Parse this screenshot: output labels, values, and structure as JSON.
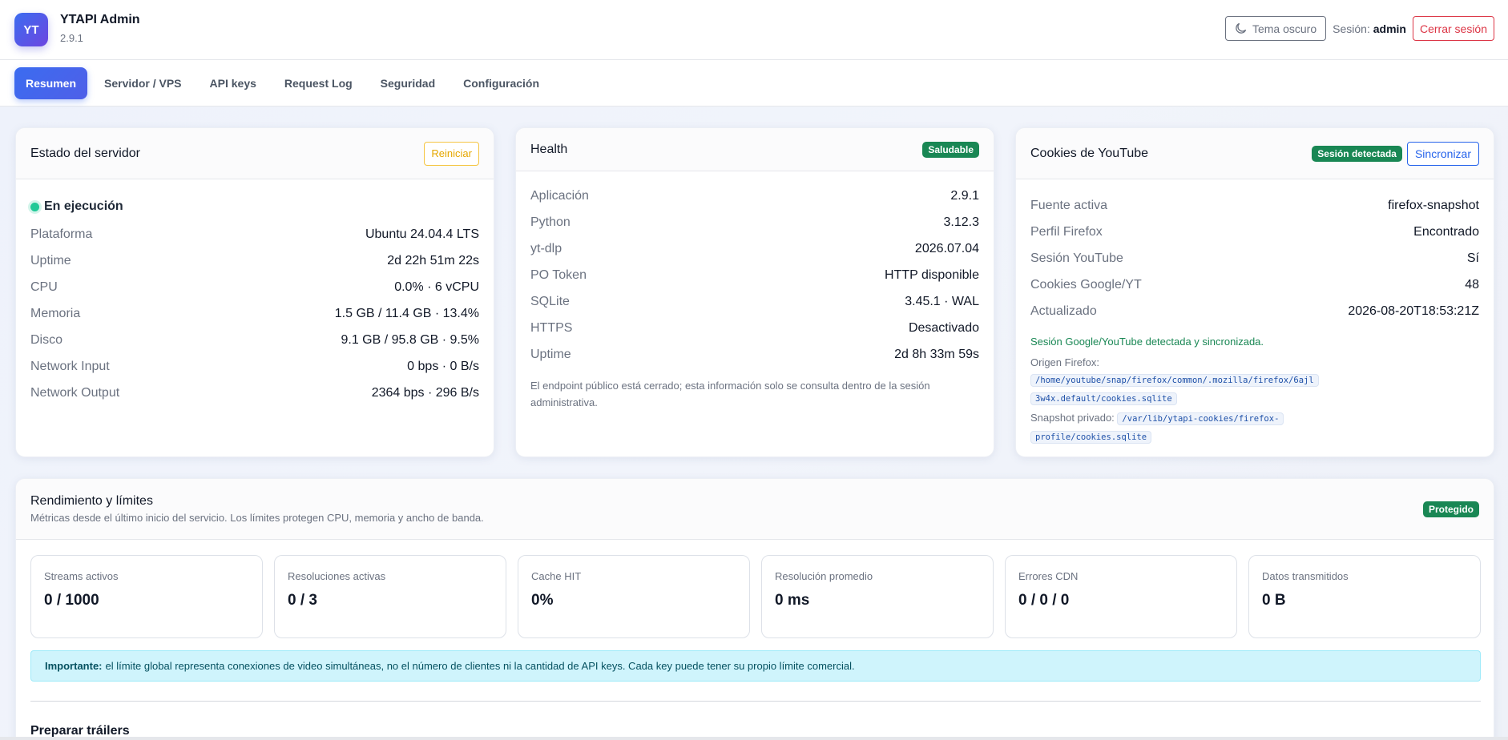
{
  "app": {
    "logo_text": "YT",
    "name": "YTAPI Admin",
    "version": "2.9.1"
  },
  "header": {
    "theme_button": "Tema oscuro",
    "session_label": "Sesión:",
    "session_user": "admin",
    "logout_button": "Cerrar sesión"
  },
  "nav": {
    "tabs": [
      {
        "label": "Resumen",
        "active": true
      },
      {
        "label": "Servidor / VPS",
        "active": false
      },
      {
        "label": "API keys",
        "active": false
      },
      {
        "label": "Request Log",
        "active": false
      },
      {
        "label": "Seguridad",
        "active": false
      },
      {
        "label": "Configuración",
        "active": false
      }
    ]
  },
  "server_card": {
    "title": "Estado del servidor",
    "restart_button": "Reiniciar",
    "status": "En ejecución",
    "rows": [
      {
        "key": "Plataforma",
        "value": "Ubuntu 24.04.4 LTS"
      },
      {
        "key": "Uptime",
        "value": "2d 22h 51m 22s"
      },
      {
        "key": "CPU",
        "value": "0.0% · 6 vCPU"
      },
      {
        "key": "Memoria",
        "value": "1.5 GB / 11.4 GB · 13.4%"
      },
      {
        "key": "Disco",
        "value": "9.1 GB / 95.8 GB · 9.5%"
      },
      {
        "key": "Network Input",
        "value": "0 bps · 0 B/s"
      },
      {
        "key": "Network Output",
        "value": "2364 bps · 296 B/s"
      }
    ]
  },
  "health_card": {
    "title": "Health",
    "badge": "Saludable",
    "rows": [
      {
        "key": "Aplicación",
        "value": "2.9.1"
      },
      {
        "key": "Python",
        "value": "3.12.3"
      },
      {
        "key": "yt-dlp",
        "value": "2026.07.04"
      },
      {
        "key": "PO Token",
        "value": "HTTP disponible"
      },
      {
        "key": "SQLite",
        "value": "3.45.1 · WAL"
      },
      {
        "key": "HTTPS",
        "value": "Desactivado"
      },
      {
        "key": "Uptime",
        "value": "2d 8h 33m 59s"
      }
    ],
    "note": "El endpoint público está cerrado; esta información solo se consulta dentro de la sesión administrativa."
  },
  "cookies_card": {
    "title": "Cookies de YouTube",
    "badge": "Sesión detectada",
    "sync_button": "Sincronizar",
    "rows": [
      {
        "key": "Fuente activa",
        "value": "firefox-snapshot"
      },
      {
        "key": "Perfil Firefox",
        "value": "Encontrado"
      },
      {
        "key": "Sesión YouTube",
        "value": "Sí"
      },
      {
        "key": "Cookies Google/YT",
        "value": "48"
      },
      {
        "key": "Actualizado",
        "value": "2026-08-20T18:53:21Z"
      }
    ],
    "success_message": "Sesión Google/YouTube detectada y sincronizada.",
    "origin_label": "Origen Firefox:",
    "origin_path_1": "/home/youtube/snap/firefox/common/.mozilla/firefox/6ajl",
    "origin_path_2": "3w4x.default/cookies.sqlite",
    "snapshot_label": "Snapshot privado:",
    "snapshot_path_1": "/var/lib/ytapi-cookies/firefox-",
    "snapshot_path_2": "profile/cookies.sqlite"
  },
  "performance": {
    "title": "Rendimiento y límites",
    "subtitle": "Métricas desde el último inicio del servicio. Los límites protegen CPU, memoria y ancho de banda.",
    "badge": "Protegido",
    "metrics": [
      {
        "label": "Streams activos",
        "value": "0 / 1000"
      },
      {
        "label": "Resoluciones activas",
        "value": "0 / 3"
      },
      {
        "label": "Cache HIT",
        "value": "0%"
      },
      {
        "label": "Resolución promedio",
        "value": "0 ms"
      },
      {
        "label": "Errores CDN",
        "value": "0 / 0 / 0"
      },
      {
        "label": "Datos transmitidos",
        "value": "0 B"
      }
    ],
    "alert_bold": "Importante:",
    "alert_text": "el límite global representa conexiones de video simultáneas, no el número de clientes ni la cantidad de API keys. Cada key puede tener su propio límite comercial.",
    "next_section_title": "Preparar tráilers"
  },
  "colors": {
    "accent": "#3b6cf0",
    "success": "#198754",
    "danger": "#dc3545",
    "warning": "#f5c542",
    "info_bg": "#cff4fc"
  },
  "icons": {
    "theme": "moon-icon",
    "status": "status-dot-icon"
  }
}
